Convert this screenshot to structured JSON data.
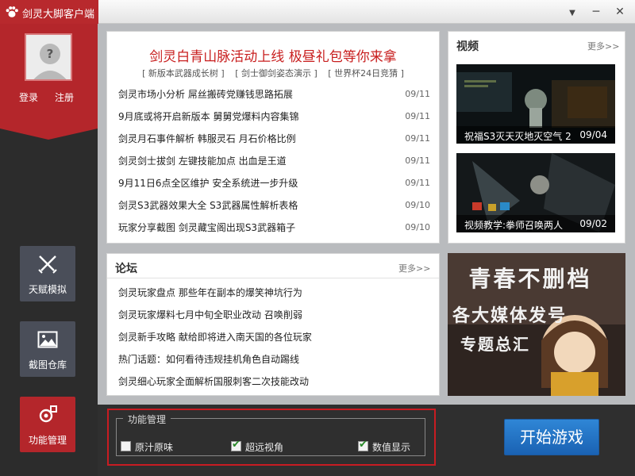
{
  "window": {
    "title": "剑灵大脚客户端"
  },
  "user": {
    "login": "登录",
    "register": "注册"
  },
  "sidebar": {
    "items": [
      {
        "label": "天赋模拟",
        "icon": "crossed-swords-icon",
        "active": false
      },
      {
        "label": "截图仓库",
        "icon": "image-icon",
        "active": false
      },
      {
        "label": "功能管理",
        "icon": "settings-icon",
        "active": true
      }
    ]
  },
  "news": {
    "headline": "剑灵白青山脉活动上线 极昼礼包等你来拿",
    "tags": [
      "[ 新版本武器成长树 ]",
      "[ 剑士御剑姿态演示 ]",
      "[ 世界杯24日竞猜 ]"
    ],
    "items": [
      {
        "title": "剑灵市场小分析  屌丝搬砖党赚钱思路拓展",
        "date": "09/11"
      },
      {
        "title": "9月底或将开启新版本  舅舅党爆料内容集锦",
        "date": "09/11"
      },
      {
        "title": "剑灵月石事件解析  韩服灵石  月石价格比例",
        "date": "09/11"
      },
      {
        "title": "剑灵剑士拔剑  左键技能加点  出血是王道",
        "date": "09/11"
      },
      {
        "title": "9月11日6点全区维护  安全系统进一步升级",
        "date": "09/11"
      },
      {
        "title": "剑灵S3武器效果大全  S3武器属性解析表格",
        "date": "09/10"
      },
      {
        "title": "玩家分享截图  剑灵藏宝阁出现S3武器箱子",
        "date": "09/10"
      }
    ]
  },
  "video": {
    "title": "视频",
    "more": "更多>>",
    "items": [
      {
        "caption": "祝福S3灭天灭地灭空气 2",
        "date": "09/04"
      },
      {
        "caption": "视频教学:拳师召唤两人",
        "date": "09/02"
      }
    ]
  },
  "forum": {
    "title": "论坛",
    "more": "更多>>",
    "items": [
      "剑灵玩家盘点  那些年在副本的爆笑神坑行为",
      "剑灵玩家爆料七月中旬全职业改动  召唤削弱",
      "剑灵新手攻略  献给即将进入南天国的各位玩家",
      "热门话题：如何看待违规挂机角色自动踢线",
      "剑灵细心玩家全面解析国服刺客二次技能改动"
    ]
  },
  "banner": {
    "line1": "青春不删档",
    "line2": "各大媒体发号",
    "line3": "专题总汇"
  },
  "func": {
    "legend": "功能管理",
    "options": [
      {
        "label": "原汁原味",
        "checked": false
      },
      {
        "label": "超远视角",
        "checked": true
      },
      {
        "label": "数值显示",
        "checked": true
      }
    ]
  },
  "start_label": "开始游戏",
  "colors": {
    "brand_red": "#b4262b",
    "accent_blue": "#1f6fc4",
    "headline_red": "#c81e1e",
    "sidebar_bg": "#2c2c2c"
  },
  "window_buttons": {
    "menu": "▼",
    "minimize": "─",
    "close": "✕"
  }
}
